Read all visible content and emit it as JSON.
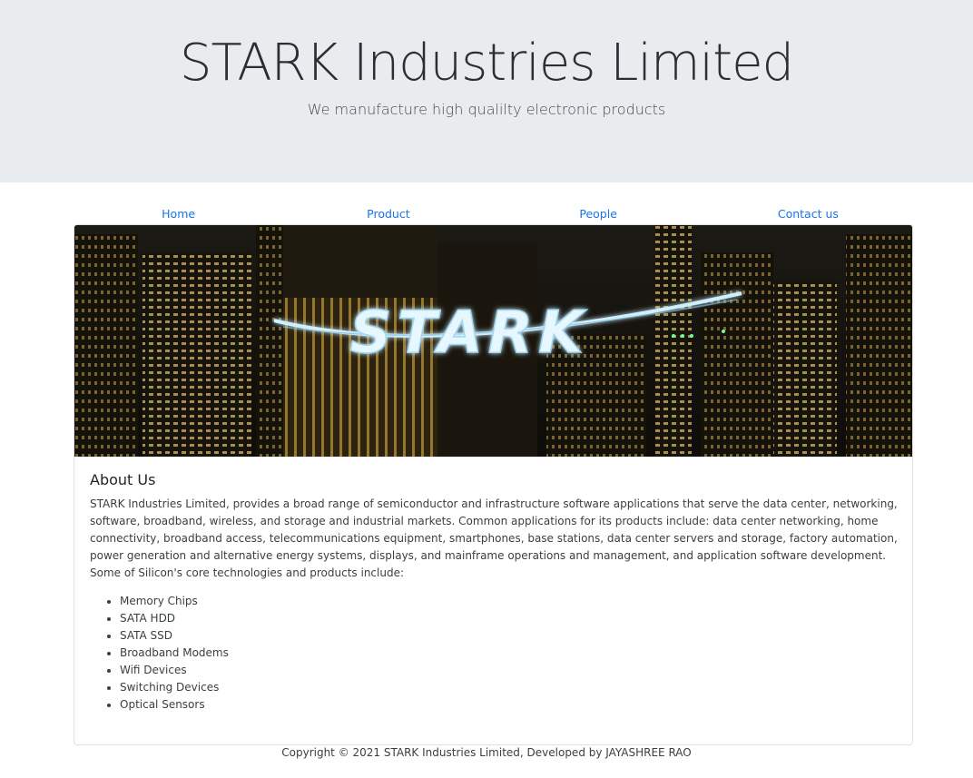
{
  "header": {
    "title": "STARK Industries Limited",
    "tagline": "We manufacture high qualilty electronic products"
  },
  "nav": {
    "items": [
      "Home",
      "Product",
      "People",
      "Contact us"
    ],
    "link_color": "#1a73e8"
  },
  "banner": {
    "logo_text": "STARK",
    "image": "city-night-skyline-with-glowing-logo"
  },
  "about": {
    "title": "About Us",
    "text": "STARK Industries Limited, provides a broad range of semiconductor and infrastructure software applications that serve the data center, networking, software, broadband, wireless, and storage and industrial markets. Common applications for its products include: data center networking, home connectivity, broadband access, telecommunications equipment, smartphones, base stations, data center servers and storage, factory automation, power generation and alternative energy systems, displays, and mainframe operations and management, and application software development. Some of Silicon's core technologies and products include:",
    "products": [
      "Memory Chips",
      "SATA HDD",
      "SATA SSD",
      "Broadband Modems",
      "Wifi Devices",
      "Switching Devices",
      "Optical Sensors"
    ]
  },
  "footer": {
    "text": "Copyright © 2021 STARK Industries Limited, Developed by JAYASHREE RAO"
  },
  "colors": {
    "jumbotron_bg": "#e9ecef",
    "link": "#1a73e8",
    "logo_glow": "#bfe9ff"
  }
}
